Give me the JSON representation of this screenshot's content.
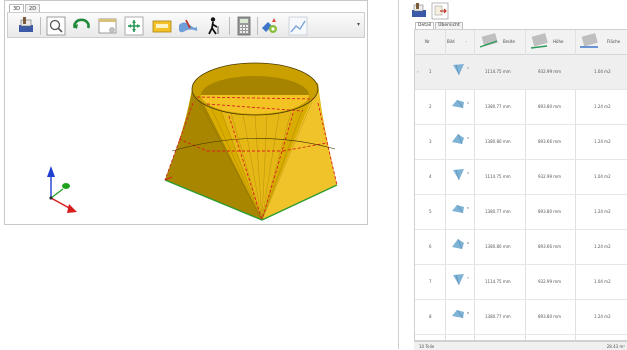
{
  "viewer": {
    "tabs": [
      "3D",
      "2D"
    ],
    "toolbar_icons": [
      "print-icon",
      "zoom-icon",
      "rotate-icon",
      "view-window-icon",
      "fit-arrows-icon",
      "label-icon",
      "surface-tool-icon",
      "walk-person-icon",
      "calculator-icon",
      "settings-gear-icon",
      "chart-icon"
    ],
    "dropdown": "▾"
  },
  "detail": {
    "toolbar_icons": [
      "print-icon",
      "export-icon"
    ],
    "tabs": [
      "Detail",
      "Übersicht"
    ],
    "columns": {
      "nr": "Nr",
      "bild": "Bild",
      "breite": "Breite",
      "hohe": "Höhe",
      "flache": "Fläche"
    },
    "rows": [
      {
        "nr": "1",
        "breite": "1114.75 mm",
        "hohe": "932.99 mm",
        "flache": "1.04 m2",
        "num": "1"
      },
      {
        "nr": "2",
        "breite": "1380.77 mm",
        "hohe": "893.80 mm",
        "flache": "1.24 m2",
        "num": "2"
      },
      {
        "nr": "3",
        "breite": "1380.80 mm",
        "hohe": "893.66 mm",
        "flache": "1.24 m2",
        "num": "3"
      },
      {
        "nr": "4",
        "breite": "1114.75 mm",
        "hohe": "932.99 mm",
        "flache": "1.04 m2",
        "num": "4"
      },
      {
        "nr": "5",
        "breite": "1380.77 mm",
        "hohe": "893.80 mm",
        "flache": "1.24 m2",
        "num": "5"
      },
      {
        "nr": "6",
        "breite": "1380.80 mm",
        "hohe": "893.66 mm",
        "flache": "1.24 m2",
        "num": "6"
      },
      {
        "nr": "7",
        "breite": "1114.75 mm",
        "hohe": "932.99 mm",
        "flache": "1.04 m2",
        "num": "7"
      },
      {
        "nr": "8",
        "breite": "1380.77 mm",
        "hohe": "893.80 mm",
        "flache": "1.24 m2",
        "num": "8"
      }
    ],
    "status_left": "10 Teile",
    "status_right": "28.43 m²"
  },
  "colors": {
    "shape_yellow": "#f1c40f",
    "shape_dark": "#7a5c00",
    "edge_red": "#d62020",
    "edge_green": "#2e9b2e",
    "axis_blue": "#1f3fd0",
    "axis_green": "#1fa01f",
    "axis_red": "#d81c1c"
  }
}
